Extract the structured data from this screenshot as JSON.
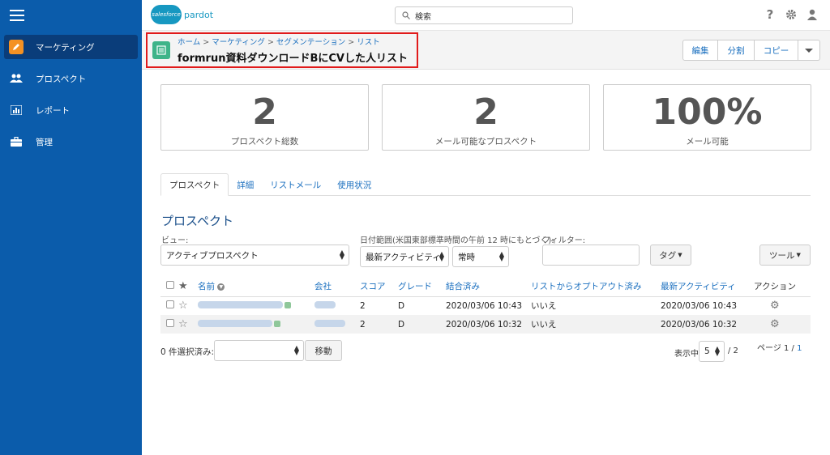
{
  "sidebar": {
    "items": [
      {
        "label": "マーケティング",
        "icon": "pencil-icon",
        "active": true
      },
      {
        "label": "プロスペクト",
        "icon": "people-icon"
      },
      {
        "label": "レポート",
        "icon": "bar-chart-icon"
      },
      {
        "label": "管理",
        "icon": "briefcase-icon"
      }
    ]
  },
  "header": {
    "logo_text": "salesforce",
    "product": "pardot",
    "search_placeholder": "検索",
    "icons": [
      "help-icon",
      "settings-icon",
      "user-icon"
    ]
  },
  "title": {
    "breadcrumb": [
      "ホーム",
      "マーケティング",
      "セグメンテーション",
      "リスト"
    ],
    "breadcrumb_sep": ">",
    "text": "formrun資料ダウンロードBにCVした人リスト"
  },
  "actions": {
    "edit": "編集",
    "split": "分割",
    "copy": "コピー"
  },
  "stats": [
    {
      "value": "2",
      "label": "プロスペクト総数"
    },
    {
      "value": "2",
      "label": "メール可能なプロスペクト"
    },
    {
      "value": "100%",
      "label": "メール可能"
    }
  ],
  "tabs": [
    "プロスペクト",
    "詳細",
    "リストメール",
    "使用状況"
  ],
  "section_title": "プロスペクト",
  "filters": {
    "view_label": "ビュー:",
    "view_value": "アクティブプロスペクト",
    "date_label": "日付範囲(米国東部標準時間の午前 12 時にもとづく):",
    "date_value": "最新アクティビティ",
    "time_value": "常時",
    "filter_label": "フィルター:",
    "filter_value": "",
    "tag_button": "タグ",
    "tool_button": "ツール"
  },
  "table": {
    "headers": [
      "名前",
      "会社",
      "スコア",
      "グレード",
      "結合済み",
      "リストからオプトアウト済み",
      "最新アクティビティ",
      "アクション"
    ],
    "rows": [
      {
        "score": "2",
        "grade": "D",
        "merged": "2020/03/06 10:43",
        "optout": "いいえ",
        "activity": "2020/03/06 10:43"
      },
      {
        "score": "2",
        "grade": "D",
        "merged": "2020/03/06 10:32",
        "optout": "いいえ",
        "activity": "2020/03/06 10:32"
      }
    ]
  },
  "footer": {
    "selected_label": "0 件選択済み:",
    "move_button": "移動",
    "per_page_label": "表示中",
    "per_page_value": "5",
    "per_page_total": "/ 2",
    "page_label": "ページ 1 /",
    "page_link": "1"
  },
  "colors": {
    "sidebar": "#0b5cab",
    "link": "#1a6fbf",
    "highlight": "#e11a1a",
    "list_icon": "#3eb489"
  }
}
